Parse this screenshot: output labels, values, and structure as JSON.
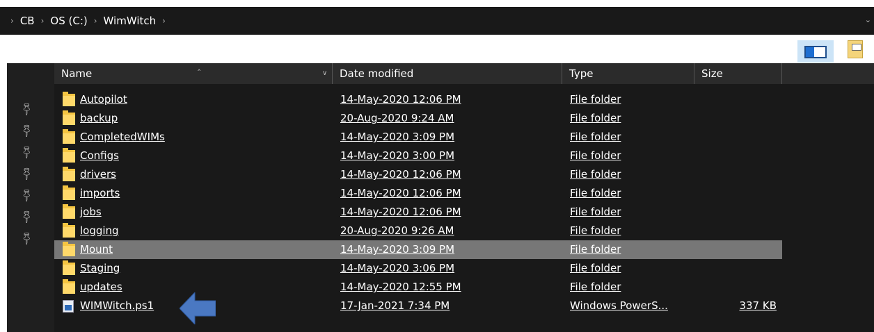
{
  "breadcrumb": {
    "items": [
      "CB",
      "OS (C:)",
      "WimWitch"
    ]
  },
  "columns": {
    "name": "Name",
    "date": "Date modified",
    "type": "Type",
    "size": "Size"
  },
  "files": [
    {
      "name": "Autopilot",
      "date": "14-May-2020 12:06 PM",
      "type": "File folder",
      "size": "",
      "icon": "folder-icon"
    },
    {
      "name": "backup",
      "date": "20-Aug-2020 9:24 AM",
      "type": "File folder",
      "size": "",
      "icon": "folder-icon"
    },
    {
      "name": "CompletedWIMs",
      "date": "14-May-2020 3:09 PM",
      "type": "File folder",
      "size": "",
      "icon": "folder-icon"
    },
    {
      "name": "Configs",
      "date": "14-May-2020 3:00 PM",
      "type": "File folder",
      "size": "",
      "icon": "folder-icon"
    },
    {
      "name": "drivers",
      "date": "14-May-2020 12:06 PM",
      "type": "File folder",
      "size": "",
      "icon": "folder-icon"
    },
    {
      "name": "imports",
      "date": "14-May-2020 12:06 PM",
      "type": "File folder",
      "size": "",
      "icon": "folder-icon"
    },
    {
      "name": "jobs",
      "date": "14-May-2020 12:06 PM",
      "type": "File folder",
      "size": "",
      "icon": "folder-icon"
    },
    {
      "name": "logging",
      "date": "20-Aug-2020 9:26 AM",
      "type": "File folder",
      "size": "",
      "icon": "folder-icon"
    },
    {
      "name": "Mount",
      "date": "14-May-2020 3:09 PM",
      "type": "File folder",
      "size": "",
      "icon": "folder-icon",
      "selected": true
    },
    {
      "name": "Staging",
      "date": "14-May-2020 3:06 PM",
      "type": "File folder",
      "size": "",
      "icon": "folder-icon"
    },
    {
      "name": "updates",
      "date": "14-May-2020 12:55 PM",
      "type": "File folder",
      "size": "",
      "icon": "folder-icon"
    },
    {
      "name": "WIMWitch.ps1",
      "date": "17-Jan-2021 7:34 PM",
      "type": "Windows PowerS...",
      "size": "337 KB",
      "icon": "powershell-script-icon"
    }
  ],
  "colors": {
    "background": "#191919",
    "header": "#2b2b2b",
    "selected_row": "#777777",
    "folder": "#f5c542",
    "annotation_arrow": "#4a78c2"
  }
}
